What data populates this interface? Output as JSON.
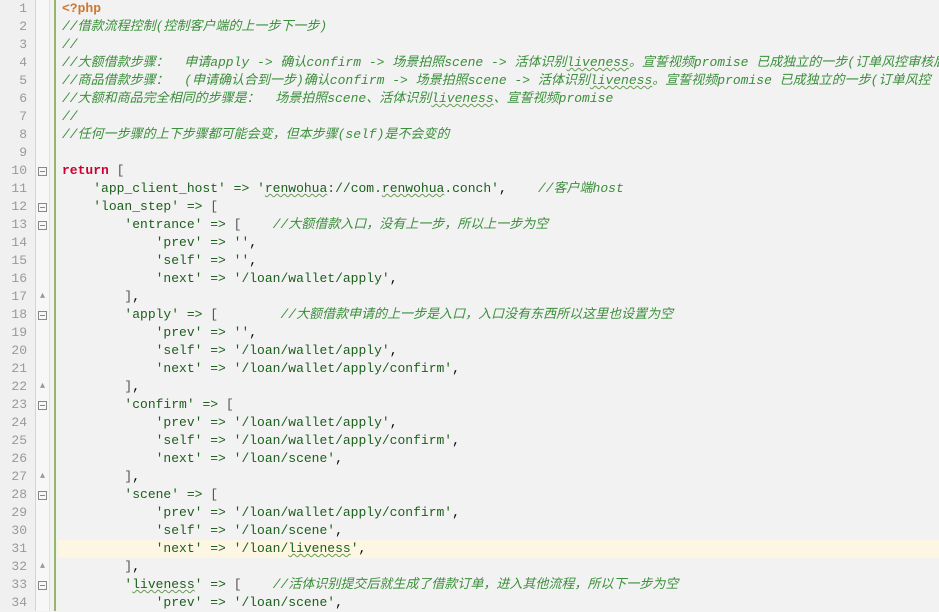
{
  "lines": [
    {
      "n": 1,
      "fold": "",
      "tokens": [
        {
          "c": "tok-tag",
          "t": "<?php"
        }
      ]
    },
    {
      "n": 2,
      "fold": "",
      "tokens": [
        {
          "c": "tok-cmt",
          "t": "//借款流程控制(控制客户端的上一步下一步)"
        }
      ]
    },
    {
      "n": 3,
      "fold": "",
      "tokens": [
        {
          "c": "tok-cmt",
          "t": "//"
        }
      ]
    },
    {
      "n": 4,
      "fold": "",
      "tokens": [
        {
          "c": "tok-cmt",
          "t": "//大额借款步骤：  申请apply -> 确认confirm -> 场景拍照scene -> 活体识别"
        },
        {
          "c": "tok-cmt wavy",
          "t": "liveness"
        },
        {
          "c": "tok-cmt",
          "t": "。宣誓视频promise 已成独立的一步(订单风控审核后"
        }
      ]
    },
    {
      "n": 5,
      "fold": "",
      "tokens": [
        {
          "c": "tok-cmt",
          "t": "//商品借款步骤：  (申请确认合到一步)确认confirm -> 场景拍照scene -> 活体识别"
        },
        {
          "c": "tok-cmt wavy",
          "t": "liveness"
        },
        {
          "c": "tok-cmt",
          "t": "。宣誓视频promise 已成独立的一步(订单风控"
        }
      ]
    },
    {
      "n": 6,
      "fold": "",
      "tokens": [
        {
          "c": "tok-cmt",
          "t": "//大额和商品完全相同的步骤是：  场景拍照scene、活体识别"
        },
        {
          "c": "tok-cmt wavy",
          "t": "liveness"
        },
        {
          "c": "tok-cmt",
          "t": "、宣誓视频promise"
        }
      ]
    },
    {
      "n": 7,
      "fold": "",
      "tokens": [
        {
          "c": "tok-cmt",
          "t": "//"
        }
      ]
    },
    {
      "n": 8,
      "fold": "",
      "tokens": [
        {
          "c": "tok-cmt",
          "t": "//任何一步骤的上下步骤都可能会变，但本步骤(self)是不会变的"
        }
      ]
    },
    {
      "n": 9,
      "fold": "",
      "tokens": []
    },
    {
      "n": 10,
      "fold": "minus",
      "tokens": [
        {
          "c": "tok-kw",
          "t": "return"
        },
        {
          "c": "",
          "t": " "
        },
        {
          "c": "tok-br",
          "t": "["
        }
      ]
    },
    {
      "n": 11,
      "fold": "",
      "tokens": [
        {
          "c": "",
          "t": "    "
        },
        {
          "c": "tok-str",
          "t": "'app_client_host'"
        },
        {
          "c": "tok-op",
          "t": " => "
        },
        {
          "c": "tok-str",
          "t": "'"
        },
        {
          "c": "tok-str wavy",
          "t": "renwohua"
        },
        {
          "c": "tok-str",
          "t": "://com."
        },
        {
          "c": "tok-str wavy",
          "t": "renwohua"
        },
        {
          "c": "tok-str",
          "t": ".conch'"
        },
        {
          "c": "",
          "t": ",    "
        },
        {
          "c": "tok-cmt",
          "t": "//客户端host"
        }
      ]
    },
    {
      "n": 12,
      "fold": "minus",
      "tokens": [
        {
          "c": "",
          "t": "    "
        },
        {
          "c": "tok-str",
          "t": "'loan_step'"
        },
        {
          "c": "tok-op",
          "t": " => "
        },
        {
          "c": "tok-br",
          "t": "["
        }
      ]
    },
    {
      "n": 13,
      "fold": "minus",
      "tokens": [
        {
          "c": "",
          "t": "        "
        },
        {
          "c": "tok-str",
          "t": "'entrance'"
        },
        {
          "c": "tok-op",
          "t": " => "
        },
        {
          "c": "tok-br",
          "t": "["
        },
        {
          "c": "",
          "t": "    "
        },
        {
          "c": "tok-cmt",
          "t": "//大额借款入口，没有上一步，所以上一步为空"
        }
      ]
    },
    {
      "n": 14,
      "fold": "",
      "tokens": [
        {
          "c": "",
          "t": "            "
        },
        {
          "c": "tok-str",
          "t": "'prev'"
        },
        {
          "c": "tok-op",
          "t": " => "
        },
        {
          "c": "tok-str",
          "t": "''"
        },
        {
          "c": "",
          "t": ","
        }
      ]
    },
    {
      "n": 15,
      "fold": "",
      "tokens": [
        {
          "c": "",
          "t": "            "
        },
        {
          "c": "tok-str",
          "t": "'self'"
        },
        {
          "c": "tok-op",
          "t": " => "
        },
        {
          "c": "tok-str",
          "t": "''"
        },
        {
          "c": "",
          "t": ","
        }
      ]
    },
    {
      "n": 16,
      "fold": "",
      "tokens": [
        {
          "c": "",
          "t": "            "
        },
        {
          "c": "tok-str",
          "t": "'next'"
        },
        {
          "c": "tok-op",
          "t": " => "
        },
        {
          "c": "tok-str",
          "t": "'/loan/wallet/apply'"
        },
        {
          "c": "",
          "t": ","
        }
      ]
    },
    {
      "n": 17,
      "fold": "up",
      "tokens": [
        {
          "c": "",
          "t": "        "
        },
        {
          "c": "tok-br",
          "t": "]"
        },
        {
          "c": "",
          "t": ","
        }
      ]
    },
    {
      "n": 18,
      "fold": "minus",
      "tokens": [
        {
          "c": "",
          "t": "        "
        },
        {
          "c": "tok-str",
          "t": "'apply'"
        },
        {
          "c": "tok-op",
          "t": " => "
        },
        {
          "c": "tok-br",
          "t": "["
        },
        {
          "c": "",
          "t": "        "
        },
        {
          "c": "tok-cmt",
          "t": "//大额借款申请的上一步是入口，入口没有东西所以这里也设置为空"
        }
      ]
    },
    {
      "n": 19,
      "fold": "",
      "tokens": [
        {
          "c": "",
          "t": "            "
        },
        {
          "c": "tok-str",
          "t": "'prev'"
        },
        {
          "c": "tok-op",
          "t": " => "
        },
        {
          "c": "tok-str",
          "t": "''"
        },
        {
          "c": "",
          "t": ","
        }
      ]
    },
    {
      "n": 20,
      "fold": "",
      "tokens": [
        {
          "c": "",
          "t": "            "
        },
        {
          "c": "tok-str",
          "t": "'self'"
        },
        {
          "c": "tok-op",
          "t": " => "
        },
        {
          "c": "tok-str",
          "t": "'/loan/wallet/apply'"
        },
        {
          "c": "",
          "t": ","
        }
      ]
    },
    {
      "n": 21,
      "fold": "",
      "tokens": [
        {
          "c": "",
          "t": "            "
        },
        {
          "c": "tok-str",
          "t": "'next'"
        },
        {
          "c": "tok-op",
          "t": " => "
        },
        {
          "c": "tok-str",
          "t": "'/loan/wallet/apply/confirm'"
        },
        {
          "c": "",
          "t": ","
        }
      ]
    },
    {
      "n": 22,
      "fold": "up",
      "tokens": [
        {
          "c": "",
          "t": "        "
        },
        {
          "c": "tok-br",
          "t": "]"
        },
        {
          "c": "",
          "t": ","
        }
      ]
    },
    {
      "n": 23,
      "fold": "minus",
      "tokens": [
        {
          "c": "",
          "t": "        "
        },
        {
          "c": "tok-str",
          "t": "'confirm'"
        },
        {
          "c": "tok-op",
          "t": " => "
        },
        {
          "c": "tok-br",
          "t": "["
        }
      ]
    },
    {
      "n": 24,
      "fold": "",
      "tokens": [
        {
          "c": "",
          "t": "            "
        },
        {
          "c": "tok-str",
          "t": "'prev'"
        },
        {
          "c": "tok-op",
          "t": " => "
        },
        {
          "c": "tok-str",
          "t": "'/loan/wallet/apply'"
        },
        {
          "c": "",
          "t": ","
        }
      ]
    },
    {
      "n": 25,
      "fold": "",
      "tokens": [
        {
          "c": "",
          "t": "            "
        },
        {
          "c": "tok-str",
          "t": "'self'"
        },
        {
          "c": "tok-op",
          "t": " => "
        },
        {
          "c": "tok-str",
          "t": "'/loan/wallet/apply/confirm'"
        },
        {
          "c": "",
          "t": ","
        }
      ]
    },
    {
      "n": 26,
      "fold": "",
      "tokens": [
        {
          "c": "",
          "t": "            "
        },
        {
          "c": "tok-str",
          "t": "'next'"
        },
        {
          "c": "tok-op",
          "t": " => "
        },
        {
          "c": "tok-str",
          "t": "'/loan/scene'"
        },
        {
          "c": "",
          "t": ","
        }
      ]
    },
    {
      "n": 27,
      "fold": "up",
      "tokens": [
        {
          "c": "",
          "t": "        "
        },
        {
          "c": "tok-br",
          "t": "]"
        },
        {
          "c": "",
          "t": ","
        }
      ]
    },
    {
      "n": 28,
      "fold": "minus",
      "tokens": [
        {
          "c": "",
          "t": "        "
        },
        {
          "c": "tok-str",
          "t": "'scene'"
        },
        {
          "c": "tok-op",
          "t": " => "
        },
        {
          "c": "tok-br",
          "t": "["
        }
      ]
    },
    {
      "n": 29,
      "fold": "",
      "tokens": [
        {
          "c": "",
          "t": "            "
        },
        {
          "c": "tok-str",
          "t": "'prev'"
        },
        {
          "c": "tok-op",
          "t": " => "
        },
        {
          "c": "tok-str",
          "t": "'/loan/wallet/apply/confirm'"
        },
        {
          "c": "",
          "t": ","
        }
      ]
    },
    {
      "n": 30,
      "fold": "",
      "tokens": [
        {
          "c": "",
          "t": "            "
        },
        {
          "c": "tok-str",
          "t": "'self'"
        },
        {
          "c": "tok-op",
          "t": " => "
        },
        {
          "c": "tok-str",
          "t": "'/loan/scene'"
        },
        {
          "c": "",
          "t": ","
        }
      ]
    },
    {
      "n": 31,
      "fold": "",
      "hl": true,
      "tokens": [
        {
          "c": "",
          "t": "            "
        },
        {
          "c": "tok-str",
          "t": "'next'"
        },
        {
          "c": "tok-op",
          "t": " => "
        },
        {
          "c": "tok-str",
          "t": "'/loan/"
        },
        {
          "c": "tok-str wavy",
          "t": "liveness"
        },
        {
          "c": "tok-str",
          "t": "'"
        },
        {
          "c": "",
          "t": ","
        }
      ]
    },
    {
      "n": 32,
      "fold": "up",
      "tokens": [
        {
          "c": "",
          "t": "        "
        },
        {
          "c": "tok-br",
          "t": "]"
        },
        {
          "c": "",
          "t": ","
        }
      ]
    },
    {
      "n": 33,
      "fold": "minus",
      "tokens": [
        {
          "c": "",
          "t": "        "
        },
        {
          "c": "tok-str",
          "t": "'"
        },
        {
          "c": "tok-str wavy",
          "t": "liveness"
        },
        {
          "c": "tok-str",
          "t": "'"
        },
        {
          "c": "tok-op",
          "t": " => "
        },
        {
          "c": "tok-br",
          "t": "["
        },
        {
          "c": "",
          "t": "    "
        },
        {
          "c": "tok-cmt",
          "t": "//活体识别提交后就生成了借款订单，进入其他流程，所以下一步为空"
        }
      ]
    },
    {
      "n": 34,
      "fold": "",
      "tokens": [
        {
          "c": "",
          "t": "            "
        },
        {
          "c": "tok-str",
          "t": "'prev'"
        },
        {
          "c": "tok-op",
          "t": " => "
        },
        {
          "c": "tok-str",
          "t": "'/loan/scene'"
        },
        {
          "c": "",
          "t": ","
        }
      ]
    }
  ],
  "indent_base": {
    "1": 0,
    "2": 1,
    "3": 1,
    "4": 1,
    "5": 1,
    "6": 1,
    "7": 1,
    "8": 0,
    "9": 0,
    "10": 0,
    "11": 1,
    "12": 1,
    "13": 2,
    "14": 3,
    "15": 3,
    "16": 3,
    "17": 2,
    "18": 2,
    "19": 3,
    "20": 3,
    "21": 3,
    "22": 2,
    "23": 2,
    "24": 3,
    "25": 3,
    "26": 3,
    "27": 2,
    "28": 2,
    "29": 3,
    "30": 3,
    "31": 3,
    "32": 2,
    "33": 2,
    "34": 3
  }
}
